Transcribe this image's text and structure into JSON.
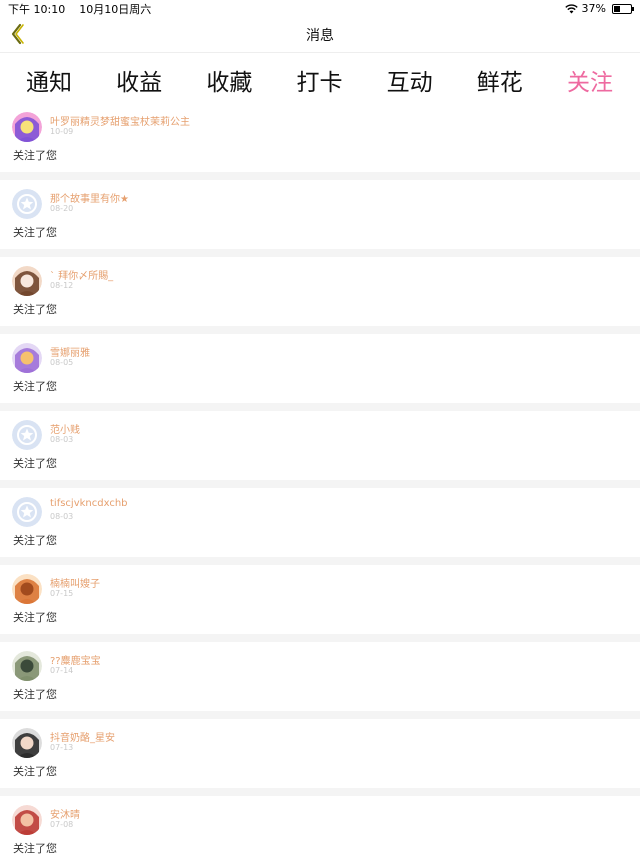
{
  "status_bar": {
    "time": "下午 10:10",
    "date": "10月10日周六",
    "battery": "37%",
    "battery_level": 0.37
  },
  "nav": {
    "title": "消息",
    "back_icon": "chevron-left-icon"
  },
  "tabs": [
    {
      "label": "通知",
      "active": false
    },
    {
      "label": "收益",
      "active": false
    },
    {
      "label": "收藏",
      "active": false
    },
    {
      "label": "打卡",
      "active": false
    },
    {
      "label": "互动",
      "active": false
    },
    {
      "label": "鲜花",
      "active": false
    },
    {
      "label": "关注",
      "active": true
    }
  ],
  "colors": {
    "accent": "#ee6aa0",
    "username": "#e6a06f",
    "date": "#c9c9c9",
    "default_avatar": "#d9e3f3"
  },
  "items": [
    {
      "username": "叶罗丽精灵梦甜蜜宝杖茉莉公主",
      "date": "10-09",
      "action": "关注了您",
      "avatar": "purple"
    },
    {
      "username": "那个故事里有你★",
      "date": "08-20",
      "action": "关注了您",
      "avatar": "default"
    },
    {
      "username": "` 拜你〆所賜_",
      "date": "08-12",
      "action": "关注了您",
      "avatar": "girl-brown"
    },
    {
      "username": "雪娜丽雅",
      "date": "08-05",
      "action": "关注了您",
      "avatar": "violet"
    },
    {
      "username": "范小贱",
      "date": "08-03",
      "action": "关注了您",
      "avatar": "default"
    },
    {
      "username": "tifscjvkncdxchb",
      "date": "08-03",
      "action": "关注了您",
      "avatar": "default"
    },
    {
      "username": "楠楠叫嫂子",
      "date": "07-15",
      "action": "关注了您",
      "avatar": "orange"
    },
    {
      "username": "??麋鹿宝宝",
      "date": "07-14",
      "action": "关注了您",
      "avatar": "deer"
    },
    {
      "username": "抖音奶酪_星安",
      "date": "07-13",
      "action": "关注了您",
      "avatar": "dark"
    },
    {
      "username": "安沐晴",
      "date": "07-08",
      "action": "关注了您",
      "avatar": "red"
    }
  ]
}
